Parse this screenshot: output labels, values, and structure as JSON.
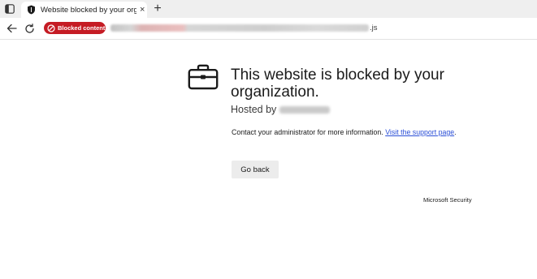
{
  "browser": {
    "tab": {
      "title": "Website blocked by your organiza",
      "close_glyph": "×",
      "favicon": "shield-icon"
    },
    "new_tab_glyph": "+",
    "address_bar": {
      "blocked_badge": "Blocked content",
      "url_visible_suffix": ".js"
    }
  },
  "page": {
    "icon": "briefcase-icon",
    "headline": "This website is blocked by your organization.",
    "hosted_prefix": "Hosted by",
    "info_text": "Contact your administrator for more information. ",
    "support_link": "Visit the support page",
    "info_suffix": ".",
    "go_back_label": "Go back",
    "footer": "Microsoft Security"
  },
  "colors": {
    "blocked_badge": "#c51c24",
    "link": "#2b4fd7",
    "button_bg": "#ececec"
  }
}
